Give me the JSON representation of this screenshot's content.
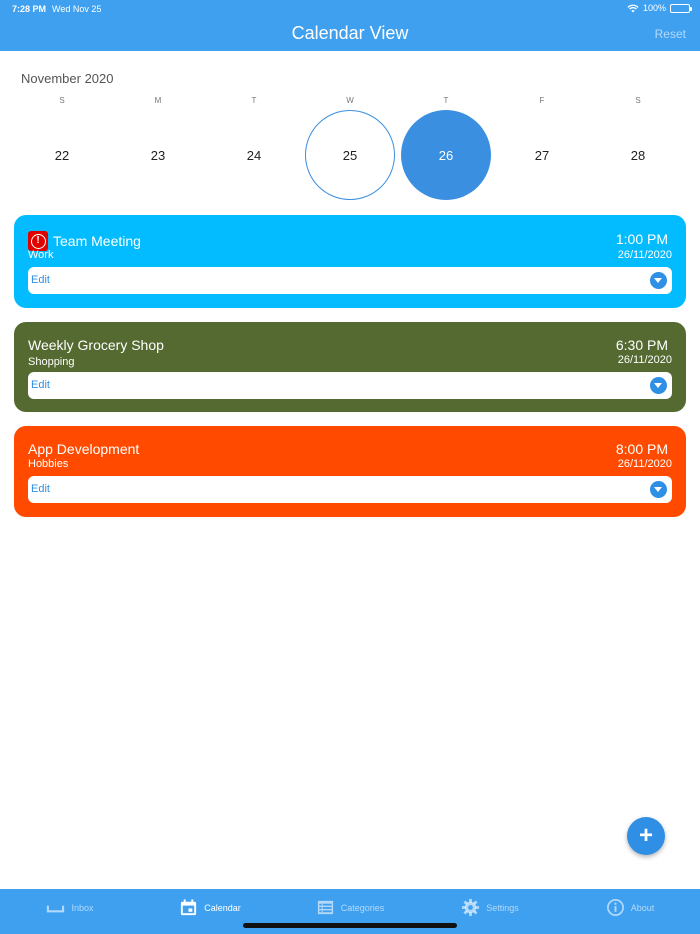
{
  "status_bar": {
    "time": "7:28 PM",
    "date": "Wed Nov 25",
    "battery": "100%"
  },
  "header": {
    "title": "Calendar View",
    "reset_label": "Reset"
  },
  "calendar": {
    "month": "November 2020",
    "weekdays": [
      "S",
      "M",
      "T",
      "W",
      "T",
      "F",
      "S"
    ],
    "days": [
      "22",
      "23",
      "24",
      "25",
      "26",
      "27",
      "28"
    ],
    "today_index": 3,
    "selected_index": 4
  },
  "events": [
    {
      "title": "Team Meeting",
      "category": "Work",
      "time": "1:00 PM",
      "date": "26/11/2020",
      "edit_label": "Edit",
      "color": "#03bcff",
      "alert": true
    },
    {
      "title": "Weekly Grocery Shop",
      "category": "Shopping",
      "time": "6:30 PM",
      "date": "26/11/2020",
      "edit_label": "Edit",
      "color": "#546a30",
      "alert": false
    },
    {
      "title": "App Development",
      "category": "Hobbies",
      "time": "8:00 PM",
      "date": "26/11/2020",
      "edit_label": "Edit",
      "color": "#ff4a00",
      "alert": false
    }
  ],
  "fab": {
    "label": "+"
  },
  "tabs": [
    {
      "label": "Inbox",
      "icon": "inbox-icon",
      "active": false
    },
    {
      "label": "Calendar",
      "icon": "calendar-icon",
      "active": true
    },
    {
      "label": "Categories",
      "icon": "list-icon",
      "active": false
    },
    {
      "label": "Settings",
      "icon": "gear-icon",
      "active": false
    },
    {
      "label": "About",
      "icon": "info-icon",
      "active": false
    }
  ],
  "colors": {
    "primary": "#3fa0f0",
    "accent": "#2f8fe4",
    "alert": "#e00000"
  }
}
